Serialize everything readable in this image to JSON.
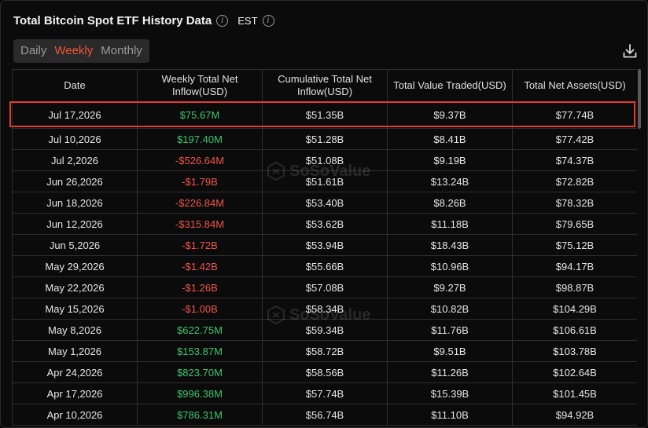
{
  "header": {
    "title": "Total Bitcoin Spot ETF History Data",
    "timezone": "EST"
  },
  "tabs": [
    {
      "label": "Daily",
      "active": false
    },
    {
      "label": "Weekly",
      "active": true
    },
    {
      "label": "Monthly",
      "active": false
    }
  ],
  "watermark": "SoSoValue",
  "columns": [
    "Date",
    "Weekly Total Net Inflow(USD)",
    "Cumulative Total Net Inflow(USD)",
    "Total Value Traded(USD)",
    "Total Net Assets(USD)"
  ],
  "rows": [
    {
      "date": "Jul 17,2026",
      "net": "$75.67M",
      "dir": "pos",
      "cum": "$51.35B",
      "traded": "$9.37B",
      "assets": "$77.74B"
    },
    {
      "date": "Jul 10,2026",
      "net": "$197.40M",
      "dir": "pos",
      "cum": "$51.28B",
      "traded": "$8.41B",
      "assets": "$77.42B"
    },
    {
      "date": "Jul 2,2026",
      "net": "-$526.64M",
      "dir": "neg",
      "cum": "$51.08B",
      "traded": "$9.19B",
      "assets": "$74.37B"
    },
    {
      "date": "Jun 26,2026",
      "net": "-$1.79B",
      "dir": "neg",
      "cum": "$51.61B",
      "traded": "$13.24B",
      "assets": "$72.82B"
    },
    {
      "date": "Jun 18,2026",
      "net": "-$226.84M",
      "dir": "neg",
      "cum": "$53.40B",
      "traded": "$8.26B",
      "assets": "$78.32B"
    },
    {
      "date": "Jun 12,2026",
      "net": "-$315.84M",
      "dir": "neg",
      "cum": "$53.62B",
      "traded": "$11.18B",
      "assets": "$79.65B"
    },
    {
      "date": "Jun 5,2026",
      "net": "-$1.72B",
      "dir": "neg",
      "cum": "$53.94B",
      "traded": "$18.43B",
      "assets": "$75.12B"
    },
    {
      "date": "May 29,2026",
      "net": "-$1.42B",
      "dir": "neg",
      "cum": "$55.66B",
      "traded": "$10.96B",
      "assets": "$94.17B"
    },
    {
      "date": "May 22,2026",
      "net": "-$1.26B",
      "dir": "neg",
      "cum": "$57.08B",
      "traded": "$9.27B",
      "assets": "$98.87B"
    },
    {
      "date": "May 15,2026",
      "net": "-$1.00B",
      "dir": "neg",
      "cum": "$58.34B",
      "traded": "$10.82B",
      "assets": "$104.29B"
    },
    {
      "date": "May 8,2026",
      "net": "$622.75M",
      "dir": "pos",
      "cum": "$59.34B",
      "traded": "$11.76B",
      "assets": "$106.61B"
    },
    {
      "date": "May 1,2026",
      "net": "$153.87M",
      "dir": "pos",
      "cum": "$58.72B",
      "traded": "$9.51B",
      "assets": "$103.78B"
    },
    {
      "date": "Apr 24,2026",
      "net": "$823.70M",
      "dir": "pos",
      "cum": "$58.56B",
      "traded": "$11.26B",
      "assets": "$102.64B"
    },
    {
      "date": "Apr 17,2026",
      "net": "$996.38M",
      "dir": "pos",
      "cum": "$57.74B",
      "traded": "$15.39B",
      "assets": "$101.45B"
    },
    {
      "date": "Apr 10,2026",
      "net": "$786.31M",
      "dir": "pos",
      "cum": "$56.74B",
      "traded": "$11.10B",
      "assets": "$94.92B"
    }
  ],
  "colors": {
    "positive": "#3ec46d",
    "negative": "#f0564a",
    "accent": "#f0563a",
    "highlight_border": "#e23b2e"
  }
}
